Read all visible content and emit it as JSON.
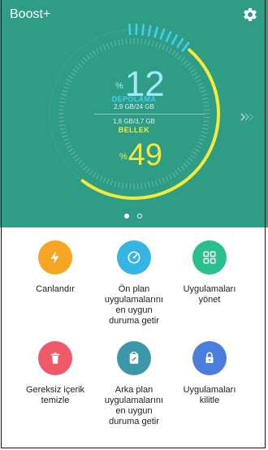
{
  "header": {
    "title": "Boost+",
    "settings_icon": "gear-icon"
  },
  "storage": {
    "percent": "12",
    "percent_sign": "%",
    "label": "DEPOLAMA",
    "usage": "2,9 GB/24 GB",
    "ratio": 0.12
  },
  "memory": {
    "percent": "49",
    "percent_sign": "%",
    "label": "BELLEK",
    "usage": "1,8 GB/3,7 GB",
    "ratio": 0.49
  },
  "pager": {
    "count": 2,
    "active_index": 0
  },
  "actions": [
    {
      "label": "Canlandır",
      "icon": "lightning-icon",
      "color": "#f5a623"
    },
    {
      "label": "Ön plan\nuygulamalarını\nen uygun\nduruma getir",
      "icon": "speedometer-icon",
      "color": "#35b5e4"
    },
    {
      "label": "Uygulamaları\nyönet",
      "icon": "app-grid-icon",
      "color": "#2bbf8f"
    },
    {
      "label": "Gereksiz içerik\ntemizle",
      "icon": "trash-icon",
      "color": "#ef5a6b"
    },
    {
      "label": "Arka plan\nuygulamalarını\nen uygun\nduruma getir",
      "icon": "clipboard-icon",
      "color": "#3c98a8"
    },
    {
      "label": "Uygulamaları\nkilitle",
      "icon": "lock-icon",
      "color": "#4a7ddc"
    }
  ],
  "colors": {
    "panel": "#2f9c86",
    "storage_accent": "#3fd0f0",
    "memory_accent": "#f4ea3a"
  }
}
